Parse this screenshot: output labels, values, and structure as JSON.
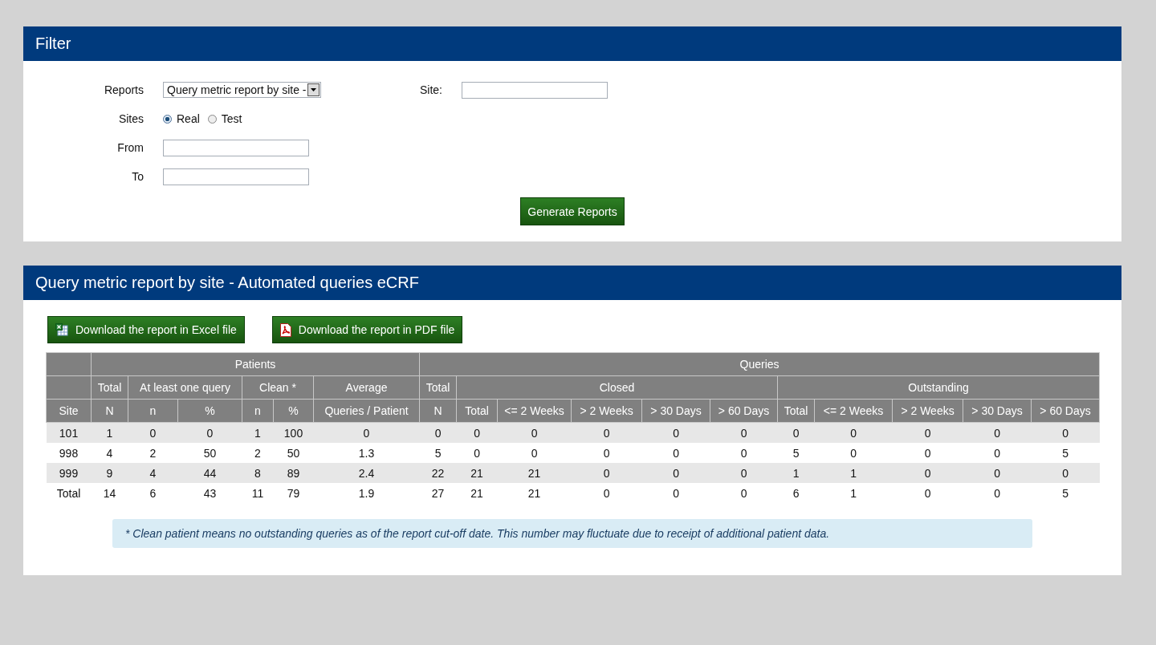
{
  "filter": {
    "title": "Filter",
    "reports": {
      "label": "Reports",
      "value": "Query metric report by site -"
    },
    "site": {
      "label": "Site:"
    },
    "sites": {
      "label": "Sites",
      "options": [
        {
          "label": "Real",
          "selected": true
        },
        {
          "label": "Test",
          "selected": false
        }
      ]
    },
    "from": {
      "label": "From"
    },
    "to": {
      "label": "To"
    },
    "generate_button": "Generate Reports"
  },
  "report": {
    "title": "Query metric report by site - Automated queries eCRF",
    "download_buttons": [
      {
        "kind": "excel",
        "label": "Download the report in Excel file"
      },
      {
        "kind": "pdf",
        "label": "Download the report in PDF file"
      }
    ],
    "table": {
      "header_rows": [
        [
          "",
          "Patients",
          "Queries"
        ],
        [
          "",
          "Total",
          "At least one query",
          "Clean *",
          "Average",
          "Total",
          "Closed",
          "Outstanding"
        ],
        [
          "Site",
          "N",
          "n",
          "%",
          "n",
          "%",
          "Queries / Patient",
          "N",
          "Total",
          "<= 2 Weeks",
          "> 2 Weeks",
          "> 30 Days",
          "> 60 Days",
          "Total",
          "<= 2 Weeks",
          "> 2 Weeks",
          "> 30 Days",
          "> 60 Days"
        ]
      ],
      "rows": [
        [
          "101",
          "1",
          "0",
          "0",
          "1",
          "100",
          "0",
          "0",
          "0",
          "0",
          "0",
          "0",
          "0",
          "0",
          "0",
          "0",
          "0",
          "0"
        ],
        [
          "998",
          "4",
          "2",
          "50",
          "2",
          "50",
          "1.3",
          "5",
          "0",
          "0",
          "0",
          "0",
          "0",
          "5",
          "0",
          "0",
          "0",
          "5"
        ],
        [
          "999",
          "9",
          "4",
          "44",
          "8",
          "89",
          "2.4",
          "22",
          "21",
          "21",
          "0",
          "0",
          "0",
          "1",
          "1",
          "0",
          "0",
          "0"
        ],
        [
          "Total",
          "14",
          "6",
          "43",
          "11",
          "79",
          "1.9",
          "27",
          "21",
          "21",
          "0",
          "0",
          "0",
          "6",
          "1",
          "0",
          "0",
          "5"
        ]
      ]
    },
    "note": "* Clean patient means no outstanding queries as of the report cut-off date. This number may fluctuate due to receipt of additional patient data."
  }
}
